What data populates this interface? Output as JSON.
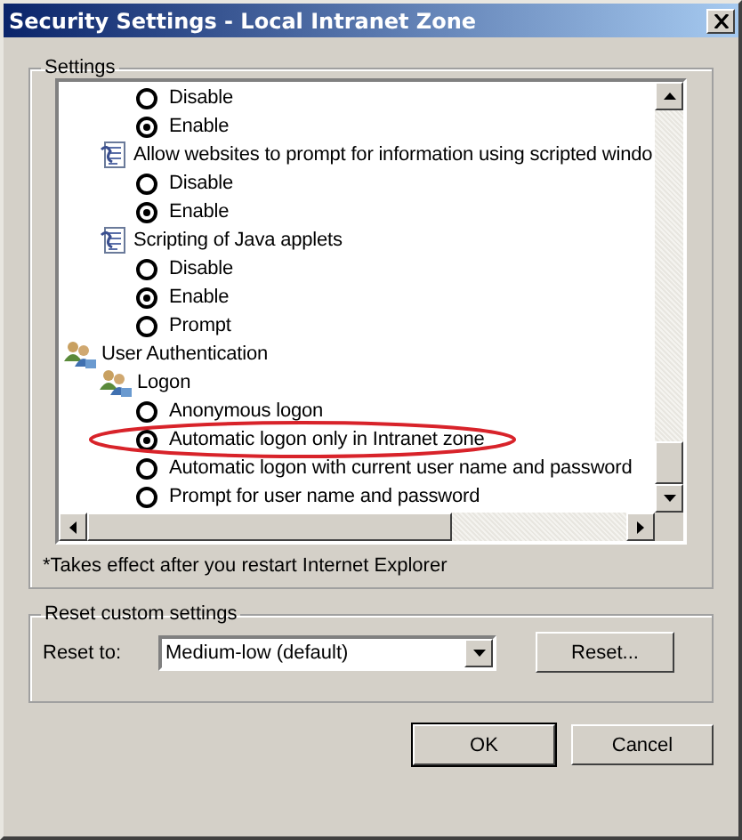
{
  "window": {
    "title": "Security Settings - Local Intranet Zone"
  },
  "settings": {
    "title": "Settings",
    "items": [
      {
        "kind": "radio",
        "label": "Disable",
        "selected": false,
        "circled": false
      },
      {
        "kind": "radio",
        "label": "Enable",
        "selected": true,
        "circled": false
      },
      {
        "kind": "setting",
        "label": "Allow websites to prompt for information using scripted windo",
        "children": [
          {
            "kind": "radio",
            "label": "Disable",
            "selected": false,
            "circled": false
          },
          {
            "kind": "radio",
            "label": "Enable",
            "selected": true,
            "circled": false
          }
        ]
      },
      {
        "kind": "setting",
        "label": "Scripting of Java applets",
        "children": [
          {
            "kind": "radio",
            "label": "Disable",
            "selected": false,
            "circled": false
          },
          {
            "kind": "radio",
            "label": "Enable",
            "selected": true,
            "circled": false
          },
          {
            "kind": "radio",
            "label": "Prompt",
            "selected": false,
            "circled": false
          }
        ]
      },
      {
        "kind": "group",
        "label": "User Authentication",
        "children": [
          {
            "kind": "group",
            "label": "Logon",
            "children": [
              {
                "kind": "radio",
                "label": "Anonymous logon",
                "selected": false,
                "circled": false
              },
              {
                "kind": "radio",
                "label": "Automatic logon only in Intranet zone",
                "selected": true,
                "circled": true
              },
              {
                "kind": "radio",
                "label": "Automatic logon with current user name and password",
                "selected": false,
                "circled": false
              },
              {
                "kind": "radio",
                "label": "Prompt for user name and password",
                "selected": false,
                "circled": false
              }
            ]
          }
        ]
      }
    ],
    "note": "*Takes effect after you restart Internet Explorer"
  },
  "reset": {
    "title": "Reset custom settings",
    "label": "Reset to:",
    "value": "Medium-low (default)",
    "button": "Reset..."
  },
  "buttons": [
    "OK",
    "Cancel"
  ]
}
